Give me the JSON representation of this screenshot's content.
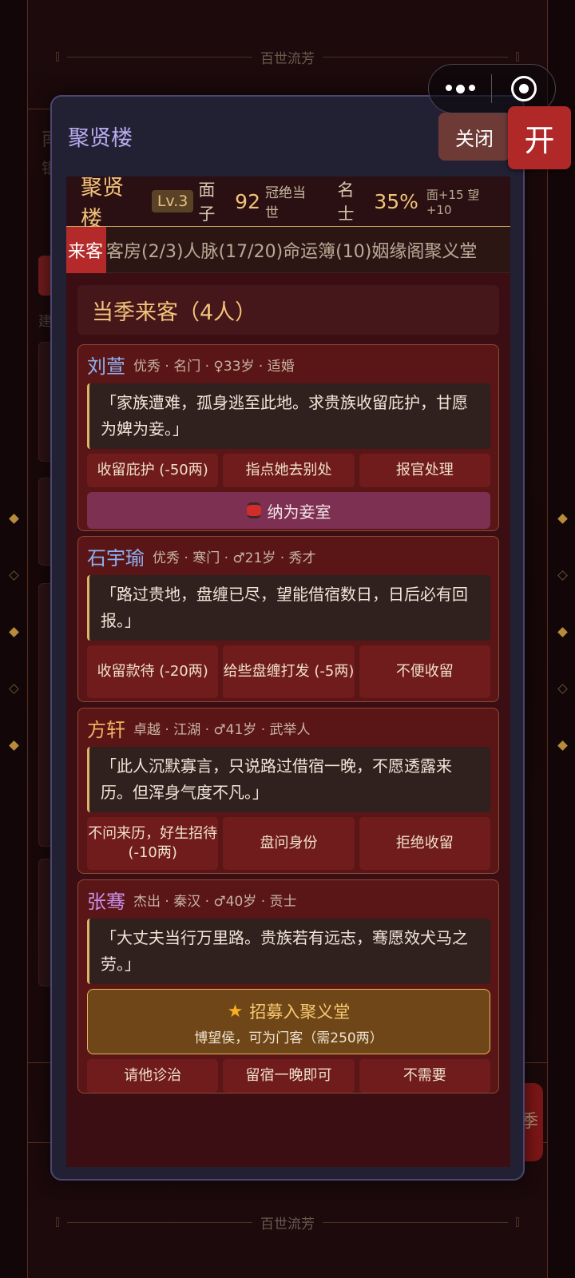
{
  "background": {
    "banner_text": "百世流芳",
    "season_label": "季",
    "behind_rows": [
      "南",
      "银",
      "建"
    ]
  },
  "capsule": {
    "more_icon": "more-dots-icon",
    "close_icon": "target-close-icon"
  },
  "open_button": {
    "label": "开"
  },
  "modal": {
    "title": "聚贤楼",
    "close_label": "关闭"
  },
  "header": {
    "name": "聚贤楼",
    "level": "Lv.3",
    "face_label": "面子",
    "face_value": "92",
    "face_title": "冠绝当世",
    "scholar_label": "名士",
    "scholar_value": "35%",
    "bonus": "面+15 望+10"
  },
  "tabs": [
    {
      "label": "来客",
      "active": true
    },
    {
      "label": "客房(2/3)",
      "active": false
    },
    {
      "label": "人脉(17/20)",
      "active": false
    },
    {
      "label": "命运簿(10)",
      "active": false
    },
    {
      "label": "姻缘阁",
      "active": false
    },
    {
      "label": "聚义堂",
      "active": false
    }
  ],
  "section_title": "当季来客（4人）",
  "guests": [
    {
      "name": "刘萱",
      "name_color": "#8cb0f0",
      "meta": "优秀 · 名门 · ♀33岁 · 适婚",
      "quote": "「家族遭难，孤身逃至此地。求贵族收留庇护，甘愿为婢为妾。」",
      "actions": [
        "收留庇护 (-50两)",
        "指点她去别处",
        "报官处理"
      ],
      "wide_action": "纳为妾室"
    },
    {
      "name": "石宇瑜",
      "name_color": "#8cb0f0",
      "meta": "优秀 · 寒门 · ♂21岁 · 秀才",
      "quote": "「路过贵地，盘缠已尽，望能借宿数日，日后必有回报。」",
      "actions": [
        "收留款待 (-20两)",
        "给些盘缠打发 (-5两)",
        "不便收留"
      ]
    },
    {
      "name": "方轩",
      "name_color": "#f3b060",
      "meta": "卓越 · 江湖 · ♂41岁 · 武举人",
      "quote": "「此人沉默寡言，只说路过借宿一晚，不愿透露来历。但浑身气度不凡。」",
      "actions": [
        "不问来历，好生招待 (-10两)",
        "盘问身份",
        "拒绝收留"
      ]
    },
    {
      "name": "张骞",
      "name_color": "#c890e8",
      "meta": "杰出 · 秦汉 · ♂40岁 · 贡士",
      "quote": "「大丈夫当行万里路。贵族若有远志，骞愿效犬马之劳。」",
      "recruit_title": "招募入聚义堂",
      "recruit_sub": "博望侯，可为门客（需250两）",
      "actions": [
        "请他诊治",
        "留宿一晚即可",
        "不需要"
      ]
    }
  ]
}
